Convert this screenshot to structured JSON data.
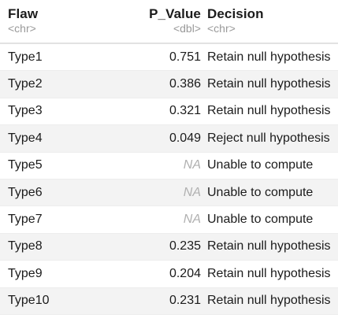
{
  "table": {
    "columns": [
      {
        "name": "Flaw",
        "type": "<chr>"
      },
      {
        "name": "P_Value",
        "type": "<dbl>"
      },
      {
        "name": "Decision",
        "type": "<chr>"
      }
    ],
    "rows": [
      {
        "flaw": "Type1",
        "p_value": "0.751",
        "decision": "Retain null hypothesis"
      },
      {
        "flaw": "Type2",
        "p_value": "0.386",
        "decision": "Retain null hypothesis"
      },
      {
        "flaw": "Type3",
        "p_value": "0.321",
        "decision": "Retain null hypothesis"
      },
      {
        "flaw": "Type4",
        "p_value": "0.049",
        "decision": "Reject null hypothesis"
      },
      {
        "flaw": "Type5",
        "p_value": "NA",
        "decision": "Unable to compute"
      },
      {
        "flaw": "Type6",
        "p_value": "NA",
        "decision": "Unable to compute"
      },
      {
        "flaw": "Type7",
        "p_value": "NA",
        "decision": "Unable to compute"
      },
      {
        "flaw": "Type8",
        "p_value": "0.235",
        "decision": "Retain null hypothesis"
      },
      {
        "flaw": "Type9",
        "p_value": "0.204",
        "decision": "Retain null hypothesis"
      },
      {
        "flaw": "Type10",
        "p_value": "0.231",
        "decision": "Retain null hypothesis"
      }
    ]
  },
  "colors": {
    "text": "#1b1b1b",
    "type_label": "#9a9a9a",
    "na": "#b0b0b0",
    "stripe": "#f3f3f3"
  }
}
